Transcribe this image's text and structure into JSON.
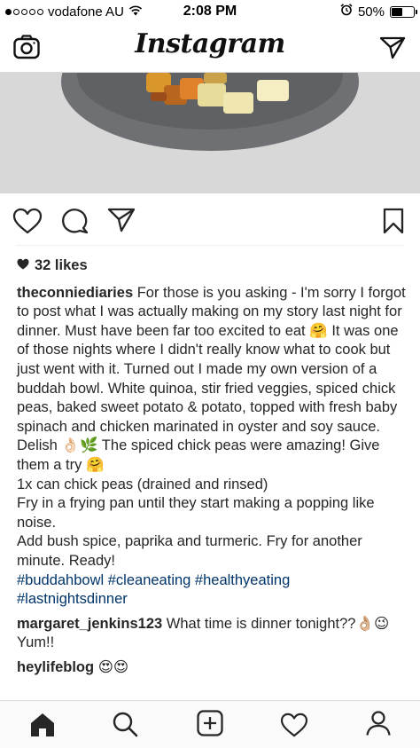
{
  "status_bar": {
    "carrier": "vodafone AU",
    "time": "2:08 PM",
    "battery": "50%",
    "battery_level": 0.5
  },
  "nav": {
    "title": "Instagram",
    "left_icon": "camera-icon",
    "right_icon": "direct-message-icon"
  },
  "actions": {
    "icons": [
      "heart-icon",
      "comment-icon",
      "share-icon",
      "bookmark-icon"
    ]
  },
  "post": {
    "likes": "32 likes",
    "username": "theconniediaries",
    "caption_lines": [
      "For those is you asking - I'm sorry I forgot to post what I was actually making on my story last night for dinner. Must have been far too excited to eat 🤗 It was one of those nights where I didn't really know what to cook but just went with it. Turned out I made my own version of a buddah bowl. White quinoa, stir fried veggies, spiced chick peas, baked sweet potato & potato, topped with fresh baby spinach and chicken marinated in oyster and soy sauce. Delish 👌🏻🌿 The spiced chick peas were amazing! Give them a try 🤗",
      "1x can chick peas (drained and rinsed)",
      "Fry in a frying pan until they start making a popping like noise.",
      "Add bush spice, paprika and turmeric. Fry for another minute. Ready!"
    ],
    "hashtags_line1": "#buddahbowl #cleaneating #healthyeating",
    "hashtags_line2": "#lastnightsdinner"
  },
  "comments": [
    {
      "username": "margaret_jenkins123",
      "text": "What time is dinner tonight??👌🏼😉 Yum!!"
    },
    {
      "username": "heylifeblog",
      "text": "😍😍"
    }
  ],
  "tab_bar": {
    "icons": [
      "home-icon",
      "search-icon",
      "add-post-icon",
      "activity-heart-icon",
      "profile-icon"
    ]
  }
}
